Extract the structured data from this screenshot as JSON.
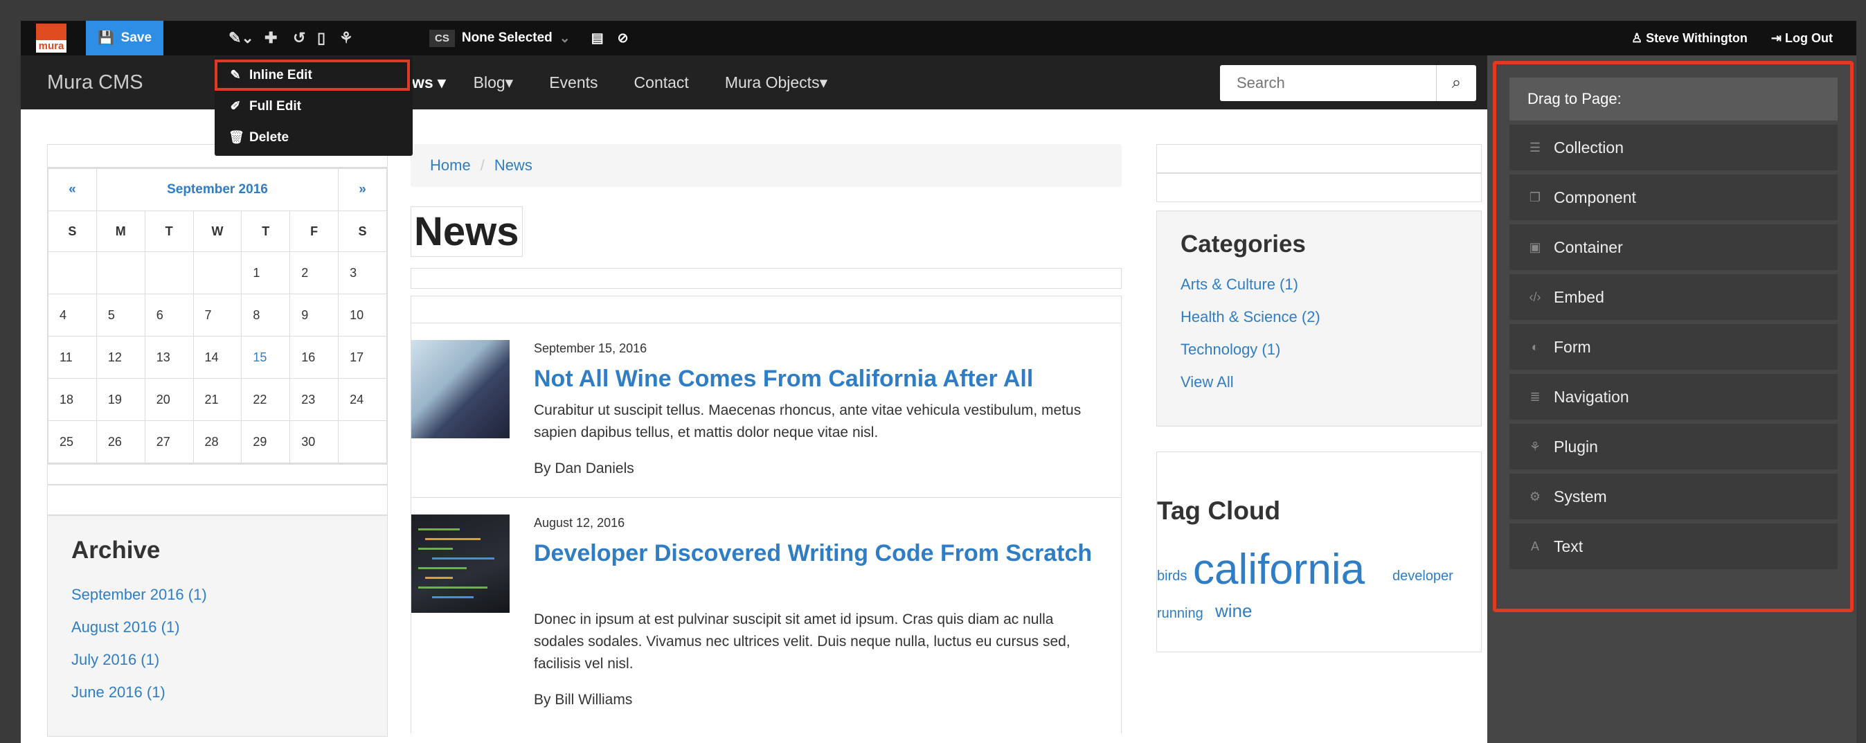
{
  "toolbar": {
    "logo": "mura",
    "save_label": "Save",
    "cs_badge": "CS",
    "content_selector": "None Selected",
    "user_name": "Steve Withington",
    "logout_label": "Log Out"
  },
  "edit_menu": {
    "items": [
      {
        "label": "Inline Edit",
        "icon": "pencil-icon"
      },
      {
        "label": "Full Edit",
        "icon": "edit-icon"
      },
      {
        "label": "Delete",
        "icon": "trash-icon"
      }
    ]
  },
  "navbar": {
    "brand": "Mura CMS",
    "links": [
      "ws",
      "Blog",
      "Events",
      "Contact",
      "Mura Objects"
    ],
    "search_placeholder": "Search"
  },
  "calendar": {
    "prev": "«",
    "month": "September 2016",
    "next": "»",
    "days_of_week": [
      "S",
      "M",
      "T",
      "W",
      "T",
      "F",
      "S"
    ],
    "weeks": [
      [
        "",
        "",
        "",
        "",
        "1",
        "2",
        "3"
      ],
      [
        "4",
        "5",
        "6",
        "7",
        "8",
        "9",
        "10"
      ],
      [
        "11",
        "12",
        "13",
        "14",
        "15",
        "16",
        "17"
      ],
      [
        "18",
        "19",
        "20",
        "21",
        "22",
        "23",
        "24"
      ],
      [
        "25",
        "26",
        "27",
        "28",
        "29",
        "30",
        ""
      ]
    ]
  },
  "archive": {
    "title": "Archive",
    "links": [
      "September 2016 (1)",
      "August 2016 (1)",
      "July 2016 (1)",
      "June 2016 (1)"
    ]
  },
  "breadcrumb": {
    "home": "Home",
    "separator": "/",
    "current": "News"
  },
  "page_title": "News",
  "articles": [
    {
      "date": "September 15, 2016",
      "title": "Not All Wine Comes From California After All",
      "body": "Curabitur ut suscipit tellus. Maecenas rhoncus, ante vitae vehicula vestibulum, metus sapien dapibus tellus, et mattis dolor neque vitae nisl.",
      "author": "By Dan Daniels"
    },
    {
      "date": "August 12, 2016",
      "title": "Developer Discovered Writing Code From Scratch",
      "body": "Donec in ipsum at est pulvinar suscipit sit amet id ipsum. Cras quis diam ac nulla sodales sodales. Vivamus nec ultrices velit. Duis neque nulla, luctus eu cursus sed, facilisis vel nisl.",
      "author": "By Bill Williams"
    }
  ],
  "categories": {
    "title": "Categories",
    "links": [
      "Arts & Culture (1)",
      "Health & Science (2)",
      "Technology (1)",
      "View All"
    ]
  },
  "tag_cloud": {
    "title": "Tag Cloud",
    "tags": [
      "birds",
      "california",
      "developer",
      "running",
      "wine"
    ]
  },
  "drag_panel": {
    "header": "Drag to Page:",
    "items": [
      {
        "label": "Collection",
        "icon": "list-icon"
      },
      {
        "label": "Component",
        "icon": "copy-icon"
      },
      {
        "label": "Container",
        "icon": "container-icon"
      },
      {
        "label": "Embed",
        "icon": "code-icon"
      },
      {
        "label": "Form",
        "icon": "toggle-icon"
      },
      {
        "label": "Navigation",
        "icon": "menu-icon"
      },
      {
        "label": "Plugin",
        "icon": "sitemap-icon"
      },
      {
        "label": "System",
        "icon": "gear-icon"
      },
      {
        "label": "Text",
        "icon": "font-icon"
      }
    ]
  },
  "colors": {
    "accent_red": "#e23a22",
    "link_blue": "#2f7dc4",
    "save_blue": "#2e8ee6",
    "logo_orange": "#e04a1f"
  }
}
